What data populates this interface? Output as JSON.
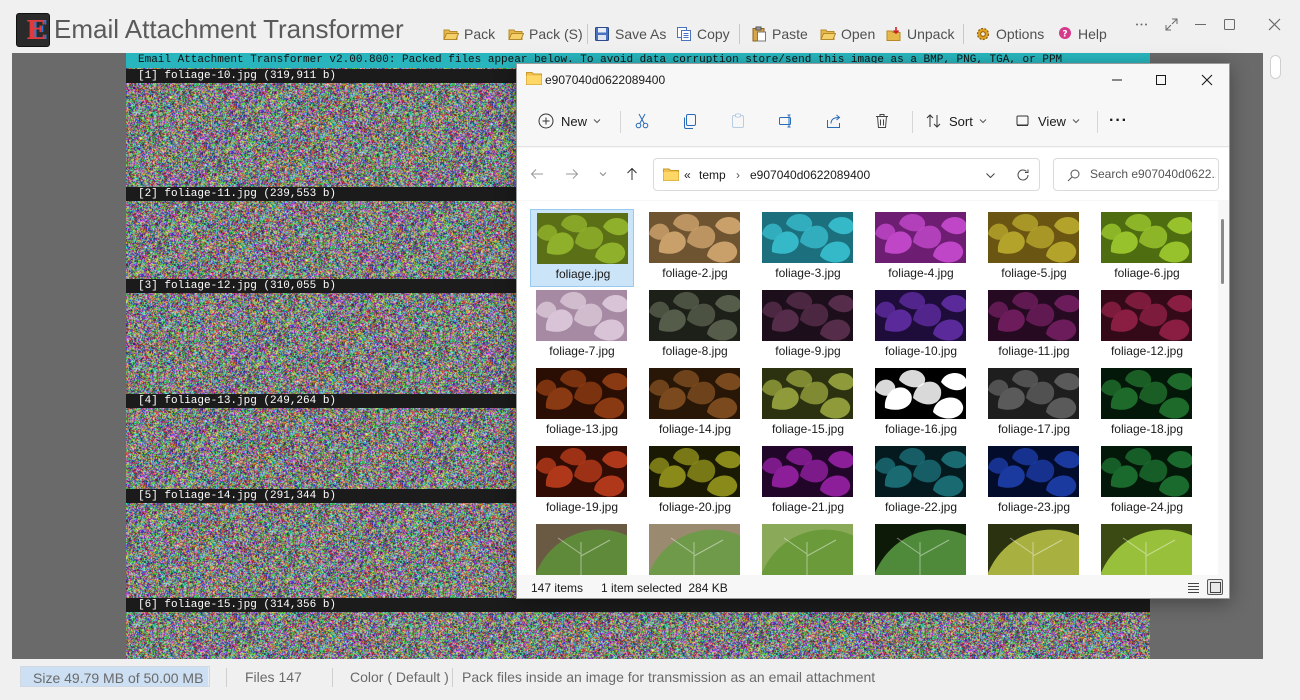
{
  "app": {
    "logo_letter": "E",
    "title": "Email Attachment Transformer"
  },
  "toolbar": {
    "pack": "Pack",
    "pack_s": "Pack (S)",
    "save_as": "Save As",
    "copy": "Copy",
    "paste": "Paste",
    "open": "Open",
    "unpack": "Unpack",
    "options": "Options",
    "help": "Help"
  },
  "canvas": {
    "banner": "Email Attachment Transformer v2.00.800: Packed files appear below. To avoid data corruption store/send this image as a BMP, PNG, TGA, or PPM",
    "file_strips": [
      "[1] foliage-10.jpg (319,911 b)",
      "[2] foliage-11.jpg (239,553 b)",
      "[3] foliage-12.jpg (310,055 b)",
      "[4] foliage-13.jpg (249,264 b)",
      "[5] foliage-14.jpg (291,344 b)",
      "[6] foliage-15.jpg (314,356 b)"
    ]
  },
  "explorer": {
    "window_title": "e907040d0622089400",
    "cmd": {
      "new": "New",
      "sort": "Sort",
      "view": "View",
      "more": "···"
    },
    "address": {
      "overflow": "«",
      "crumbs": [
        "temp",
        "e907040d0622089400"
      ]
    },
    "search_placeholder": "Search e907040d0622...",
    "files": [
      {
        "name": "foliage.jpg",
        "tint": "#8fb02a",
        "bg": "#5b6f16",
        "selected": true
      },
      {
        "name": "foliage-2.jpg",
        "tint": "#c9a06a",
        "bg": "#6f5432"
      },
      {
        "name": "foliage-3.jpg",
        "tint": "#35b8c8",
        "bg": "#1c6f7d"
      },
      {
        "name": "foliage-4.jpg",
        "tint": "#c046c8",
        "bg": "#6d1d72"
      },
      {
        "name": "foliage-5.jpg",
        "tint": "#b3a32a",
        "bg": "#6b5512"
      },
      {
        "name": "foliage-6.jpg",
        "tint": "#98c22c",
        "bg": "#4d6d10"
      },
      {
        "name": "foliage-7.jpg",
        "tint": "#d8c4d6",
        "bg": "#a68aa4"
      },
      {
        "name": "foliage-8.jpg",
        "tint": "#555c4a",
        "bg": "#1d2018"
      },
      {
        "name": "foliage-9.jpg",
        "tint": "#552c4a",
        "bg": "#1c0e1a"
      },
      {
        "name": "foliage-10.jpg",
        "tint": "#5a2a9a",
        "bg": "#1e0c3a"
      },
      {
        "name": "foliage-11.jpg",
        "tint": "#6c1c5a",
        "bg": "#260a22"
      },
      {
        "name": "foliage-12.jpg",
        "tint": "#8a1e42",
        "bg": "#340a18"
      },
      {
        "name": "foliage-13.jpg",
        "tint": "#8a3a12",
        "bg": "#2a0e04"
      },
      {
        "name": "foliage-14.jpg",
        "tint": "#7a4a1e",
        "bg": "#281606"
      },
      {
        "name": "foliage-15.jpg",
        "tint": "#8f9a3a",
        "bg": "#2c3210"
      },
      {
        "name": "foliage-16.jpg",
        "tint": "#ffffff",
        "bg": "#000000"
      },
      {
        "name": "foliage-17.jpg",
        "tint": "#5a5a5a",
        "bg": "#1e1e1e"
      },
      {
        "name": "foliage-18.jpg",
        "tint": "#1e6a2a",
        "bg": "#04180a"
      },
      {
        "name": "foliage-19.jpg",
        "tint": "#b0381a",
        "bg": "#300c04"
      },
      {
        "name": "foliage-20.jpg",
        "tint": "#8a8a1a",
        "bg": "#1a1a04"
      },
      {
        "name": "foliage-21.jpg",
        "tint": "#8c1e9a",
        "bg": "#22062a"
      },
      {
        "name": "foliage-22.jpg",
        "tint": "#1a6a72",
        "bg": "#041a1e"
      },
      {
        "name": "foliage-23.jpg",
        "tint": "#1a3aa0",
        "bg": "#040c2c"
      },
      {
        "name": "foliage-24.jpg",
        "tint": "#1a6a2e",
        "bg": "#04180a"
      },
      {
        "name": "",
        "tint": "#5f8a3a",
        "bg": "#6a5a44",
        "big": true
      },
      {
        "name": "",
        "tint": "#6f9a4a",
        "bg": "#9a8a70",
        "big": true
      },
      {
        "name": "",
        "tint": "#6a9a3a",
        "bg": "#8aaa5a",
        "big": true
      },
      {
        "name": "",
        "tint": "#4e8a3a",
        "bg": "#0e1a08",
        "big": true
      },
      {
        "name": "",
        "tint": "#a8b040",
        "bg": "#2a3210",
        "big": true
      },
      {
        "name": "",
        "tint": "#98c03a",
        "bg": "#3a4a12",
        "big": true
      }
    ],
    "status": {
      "items": "147 items",
      "selection": "1 item selected  284 KB"
    }
  },
  "statusbar": {
    "size_used": 49.79,
    "size_total": 50.0,
    "size_text": "Size 49.79 MB of 50.00 MB",
    "files": "Files 147",
    "color": "Color ( Default )",
    "hint": "Pack files inside an image for transmission as an email attachment"
  }
}
